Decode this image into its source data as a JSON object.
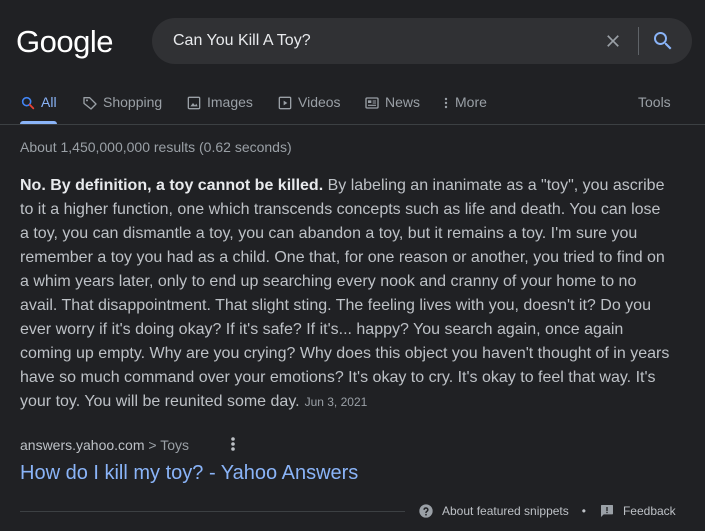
{
  "logo": {
    "text": "Google"
  },
  "search": {
    "query": "Can You Kill A Toy?"
  },
  "tabs": [
    {
      "label": "All",
      "icon": "search-icon",
      "active": true
    },
    {
      "label": "Shopping",
      "icon": "tag-icon"
    },
    {
      "label": "Images",
      "icon": "image-icon"
    },
    {
      "label": "Videos",
      "icon": "play-icon"
    },
    {
      "label": "News",
      "icon": "news-icon"
    },
    {
      "label": "More",
      "icon": "more-vert-icon"
    }
  ],
  "tools_label": "Tools",
  "result_stats": "About 1,450,000,000 results (0.62 seconds)",
  "snippet": {
    "bold": "No. By definition, a toy cannot be killed.",
    "text": " By labeling an inanimate as a \"toy\", you ascribe to it a higher function, one which transcends concepts such as life and death. You can lose a toy, you can dismantle a toy, you can abandon a toy, but it remains a toy. I'm sure you remember a toy you had as a child. One that, for one reason or another, you tried to find on a whim years later, only to end up searching every nook and cranny of your home to no avail. That disappointment. That slight sting. The feeling lives with you, doesn't it? Do you ever worry if it's doing okay? If it's safe? If it's... happy? You search again, once again coming up empty. Why are you crying? Why does this object you haven't thought of in years have so much command over your emotions? It's okay to cry. It's okay to feel that way. It's your toy. You will be reunited some day.",
    "date": "Jun 3, 2021"
  },
  "source": {
    "domain": "answers.yahoo.com",
    "crumb": " > Toys"
  },
  "result_title": "How do I kill my toy? - Yahoo Answers",
  "footer": {
    "about": "About featured snippets",
    "separator": "•",
    "feedback": "Feedback"
  },
  "colors": {
    "background": "#202124",
    "link": "#8ab4f8",
    "text": "#bdc1c6"
  }
}
